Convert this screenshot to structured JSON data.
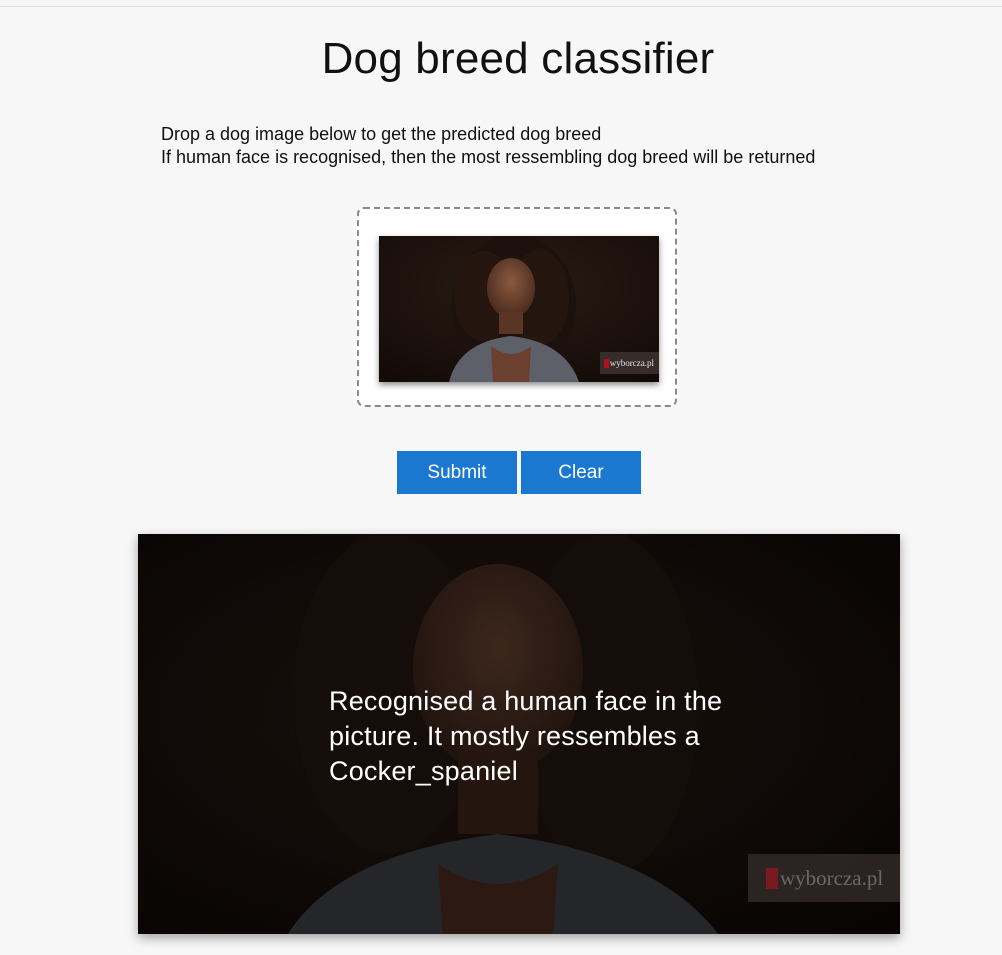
{
  "page": {
    "title": "Dog breed classifier",
    "instructions": [
      "Drop a dog image below to get the predicted dog breed",
      "If human face is recognised, then the most ressembling dog breed will be returned"
    ]
  },
  "dropzone": {
    "image_watermark": "wyborcza.pl"
  },
  "buttons": {
    "submit_label": "Submit",
    "clear_label": "Clear"
  },
  "result": {
    "message": "Recognised a human face in the picture. It mostly ressembles a Cocker_spaniel",
    "image_watermark": "wyborcza.pl"
  },
  "colors": {
    "background": "#f7f7f7",
    "button_blue": "#1b78d0",
    "dropzone_border": "#8a8a8a",
    "watermark_red": "#b01020"
  }
}
